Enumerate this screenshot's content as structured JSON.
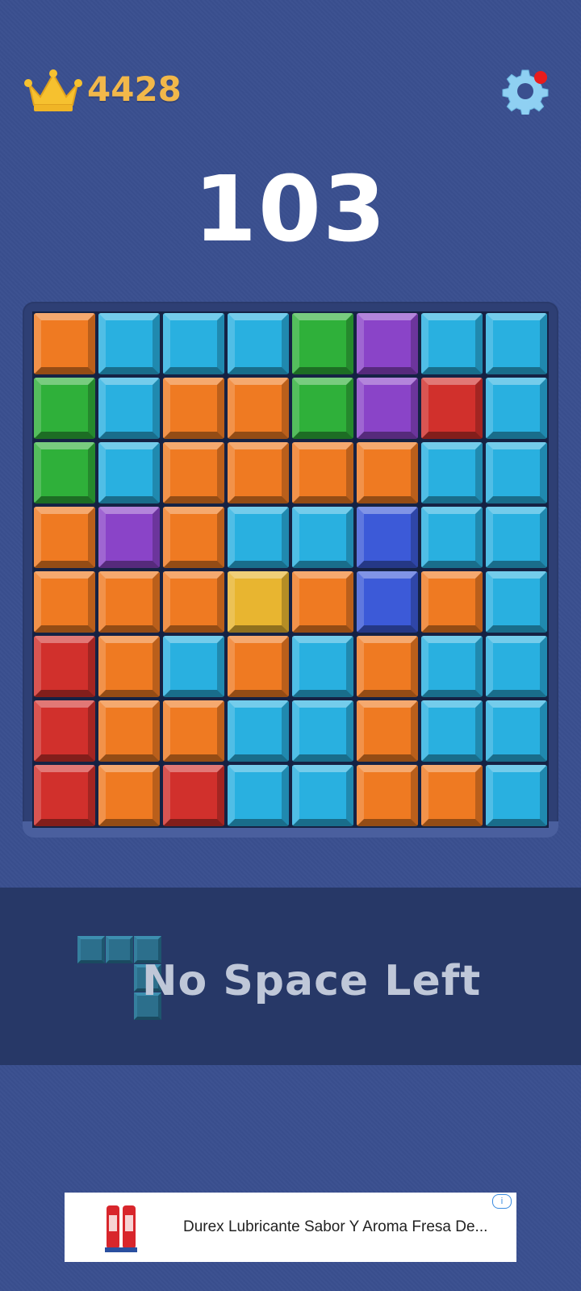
{
  "header": {
    "best_score": "4428",
    "crown_icon": "crown-icon",
    "settings_icon": "gear-icon",
    "notification_dot_color": "#e81c1c"
  },
  "score": "103",
  "board": {
    "rows": 8,
    "cols": 8,
    "cells": [
      [
        "orange",
        "cyan",
        "cyan",
        "cyan",
        "green",
        "purple",
        "cyan",
        "cyan"
      ],
      [
        "green",
        "cyan",
        "orange",
        "orange",
        "green",
        "purple",
        "red",
        "cyan"
      ],
      [
        "green",
        "cyan",
        "orange",
        "orange",
        "orange",
        "orange",
        "cyan",
        "cyan"
      ],
      [
        "orange",
        "purple",
        "orange",
        "cyan",
        "cyan",
        "blue",
        "cyan",
        "cyan"
      ],
      [
        "orange",
        "orange",
        "orange",
        "yellow",
        "orange",
        "blue",
        "orange",
        "cyan"
      ],
      [
        "red",
        "orange",
        "cyan",
        "orange",
        "cyan",
        "orange",
        "cyan",
        "cyan"
      ],
      [
        "red",
        "orange",
        "orange",
        "cyan",
        "cyan",
        "orange",
        "cyan",
        "cyan"
      ],
      [
        "red",
        "orange",
        "red",
        "cyan",
        "cyan",
        "orange",
        "orange",
        "cyan"
      ]
    ],
    "colors": {
      "orange": "#ef7a22",
      "cyan": "#29b0e0",
      "green": "#2fb03a",
      "purple": "#8a44c8",
      "red": "#d1302c",
      "blue": "#3c5ad8",
      "yellow": "#e8b530"
    }
  },
  "message": "No Space Left",
  "next_piece": {
    "color": "#2c6f8c",
    "shape": [
      [
        1,
        1,
        1
      ],
      [
        0,
        0,
        1
      ],
      [
        0,
        0,
        1
      ]
    ]
  },
  "ad": {
    "text": "Durex Lubricante Sabor Y Aroma Fresa De...",
    "info_icon": "info-icon"
  }
}
